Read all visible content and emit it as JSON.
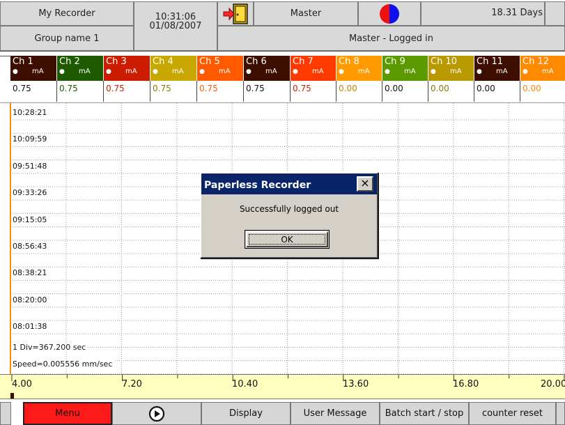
{
  "header": {
    "recorder_name": "My Recorder",
    "group_name": "Group name 1",
    "time": "10:31:06",
    "date": "01/08/2007",
    "user": "Master",
    "status": "Master - Logged in",
    "days": "18.31 Days"
  },
  "channels": [
    {
      "name": "Ch 1",
      "unit": "mA",
      "value": "0.75",
      "color": "#3d0e00",
      "value_color": "#111111"
    },
    {
      "name": "Ch 2",
      "unit": "mA",
      "value": "0.75",
      "color": "#1e5a00",
      "value_color": "#1e5a00"
    },
    {
      "name": "Ch 3",
      "unit": "mA",
      "value": "0.75",
      "color": "#cc1c00",
      "value_color": "#cc1c00"
    },
    {
      "name": "Ch 4",
      "unit": "mA",
      "value": "0.75",
      "color": "#c8a800",
      "value_color": "#8a7a00"
    },
    {
      "name": "Ch 5",
      "unit": "mA",
      "value": "0.75",
      "color": "#ff5a00",
      "value_color": "#ff5a00"
    },
    {
      "name": "Ch 6",
      "unit": "mA",
      "value": "0.75",
      "color": "#3d0e00",
      "value_color": "#111111"
    },
    {
      "name": "Ch 7",
      "unit": "mA",
      "value": "0.75",
      "color": "#ff3a00",
      "value_color": "#cc1c00"
    },
    {
      "name": "Ch 8",
      "unit": "mA",
      "value": "0.00",
      "color": "#ff9a00",
      "value_color": "#c08400"
    },
    {
      "name": "Ch 9",
      "unit": "mA",
      "value": "0.00",
      "color": "#5a9a00",
      "value_color": "#111111"
    },
    {
      "name": "Ch 10",
      "unit": "mA",
      "value": "0.00",
      "color": "#b89a00",
      "value_color": "#8a7a00"
    },
    {
      "name": "Ch 11",
      "unit": "mA",
      "value": "0.00",
      "color": "#3d0e00",
      "value_color": "#111111"
    },
    {
      "name": "Ch 12",
      "unit": "mA",
      "value": "0.00",
      "color": "#ff8a00",
      "value_color": "#ff8a00"
    }
  ],
  "chart": {
    "time_labels": [
      "10:28:21",
      "10:09:59",
      "09:51:48",
      "09:33:26",
      "09:15:05",
      "08:56:43",
      "08:38:21",
      "08:20:00",
      "08:01:38"
    ],
    "div_info": "1 Div=367.200 sec",
    "speed_info": "Speed=0.005556 mm/sec",
    "scale_labels": [
      "4.00",
      "7.20",
      "10.40",
      "13.60",
      "16.80",
      "20.00"
    ]
  },
  "dialog": {
    "title": "Paperless Recorder",
    "close_label": "×",
    "message": "Successfully logged out",
    "ok_label": "OK"
  },
  "toolbar": {
    "menu_label": "Menu",
    "display_label": "Display",
    "user_message_label": "User Message",
    "batch_label": "Batch start / stop",
    "counter_reset_label": "counter reset"
  }
}
